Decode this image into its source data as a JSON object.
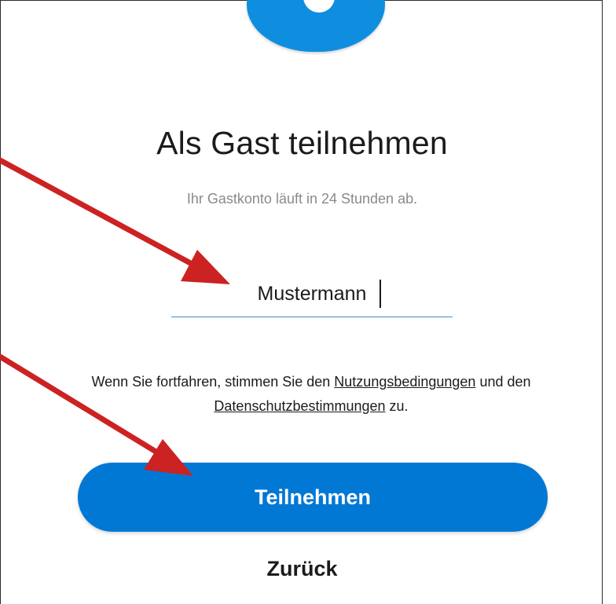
{
  "page": {
    "title": "Als Gast teilnehmen",
    "subtitle": "Ihr Gastkonto läuft in 24 Stunden ab."
  },
  "name_field": {
    "value": "Mustermann"
  },
  "terms": {
    "prefix": "Wenn Sie fortfahren, stimmen Sie den ",
    "terms_link": "Nutzungsbedingungen",
    "middle": " und den",
    "privacy_link": "Datenschutzbestimmungen",
    "suffix": " zu."
  },
  "actions": {
    "join_label": "Teilnehmen",
    "back_label": "Zurück"
  },
  "colors": {
    "accent": "#0078d4",
    "logo": "#0f8ee0",
    "annotation_arrow": "#cc2222",
    "input_underline": "#3d8fd0"
  },
  "icons": {
    "logo": "skype-logo-icon",
    "annotation": "red-arrow-annotation"
  }
}
